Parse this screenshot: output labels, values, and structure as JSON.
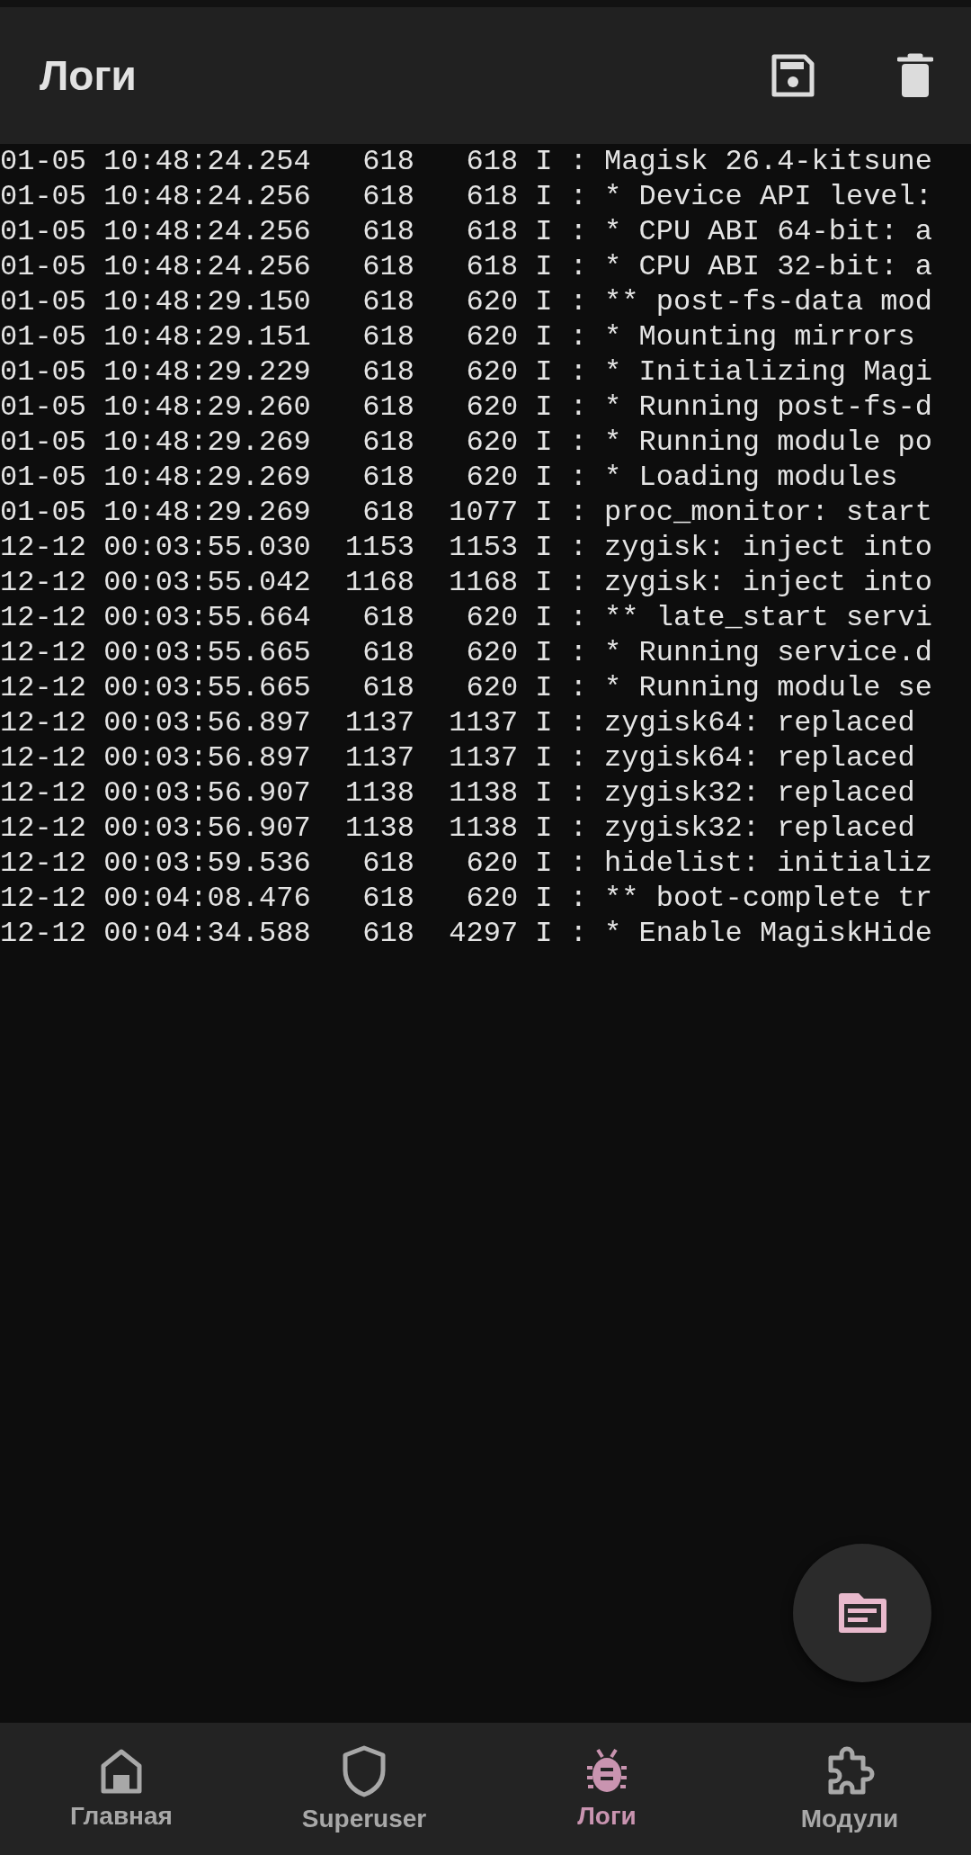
{
  "app_bar": {
    "title": "Логи"
  },
  "log_lines": [
    "01-05 10:48:24.254   618   618 I : Magisk 26.4-kitsune",
    "01-05 10:48:24.256   618   618 I : * Device API level:",
    "01-05 10:48:24.256   618   618 I : * CPU ABI 64-bit: a",
    "01-05 10:48:24.256   618   618 I : * CPU ABI 32-bit: a",
    "01-05 10:48:29.150   618   620 I : ** post-fs-data mod",
    "01-05 10:48:29.151   618   620 I : * Mounting mirrors",
    "01-05 10:48:29.229   618   620 I : * Initializing Magi",
    "01-05 10:48:29.260   618   620 I : * Running post-fs-d",
    "01-05 10:48:29.269   618   620 I : * Running module po",
    "01-05 10:48:29.269   618   620 I : * Loading modules",
    "01-05 10:48:29.269   618  1077 I : proc_monitor: start",
    "12-12 00:03:55.030  1153  1153 I : zygisk: inject into",
    "12-12 00:03:55.042  1168  1168 I : zygisk: inject into",
    "12-12 00:03:55.664   618   620 I : ** late_start servi",
    "12-12 00:03:55.665   618   620 I : * Running service.d",
    "12-12 00:03:55.665   618   620 I : * Running module se",
    "12-12 00:03:56.897  1137  1137 I : zygisk64: replaced",
    "12-12 00:03:56.897  1137  1137 I : zygisk64: replaced",
    "12-12 00:03:56.907  1138  1138 I : zygisk32: replaced",
    "12-12 00:03:56.907  1138  1138 I : zygisk32: replaced",
    "12-12 00:03:59.536   618   620 I : hidelist: initializ",
    "12-12 00:04:08.476   618   620 I : ** boot-complete tr",
    "12-12 00:04:34.588   618  4297 I : * Enable MagiskHide"
  ],
  "bottom_nav": [
    {
      "kind": "home",
      "label": "Главная",
      "selected": false
    },
    {
      "kind": "superuser",
      "label": "Superuser",
      "selected": false
    },
    {
      "kind": "logs",
      "label": "Логи",
      "selected": true
    },
    {
      "kind": "modules",
      "label": "Модули",
      "selected": false
    }
  ]
}
